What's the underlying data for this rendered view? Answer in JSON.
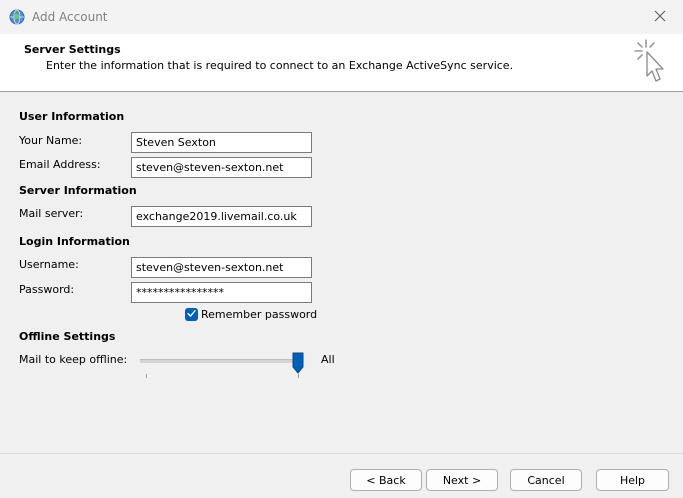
{
  "window": {
    "title": "Add Account"
  },
  "header": {
    "title": "Server Settings",
    "description": "Enter the information that is required to connect to an Exchange ActiveSync service."
  },
  "sections": {
    "user_info": "User Information",
    "server_info": "Server Information",
    "login_info": "Login Information",
    "offline": "Offline Settings"
  },
  "fields": {
    "your_name": {
      "label": "Your Name:",
      "value": "Steven Sexton"
    },
    "email": {
      "label": "Email Address:",
      "value": "steven@steven-sexton.net"
    },
    "mail_server": {
      "label": "Mail server:",
      "value": "exchange2019.livemail.co.uk"
    },
    "username": {
      "label": "Username:",
      "value": "steven@steven-sexton.net"
    },
    "password": {
      "label": "Password:",
      "value": "****************"
    }
  },
  "remember_password": {
    "label": "Remember password",
    "checked": true
  },
  "offline_slider": {
    "label": "Mail to keep offline:",
    "value_label": "All",
    "level": 1.0
  },
  "buttons": {
    "back": "< Back",
    "next": "Next >",
    "cancel": "Cancel",
    "help": "Help"
  },
  "colors": {
    "accent": "#005fb8"
  },
  "icons": {
    "app": "globe-icon",
    "close": "close-icon",
    "header": "cursor-click-icon",
    "check": "checkmark-icon"
  }
}
